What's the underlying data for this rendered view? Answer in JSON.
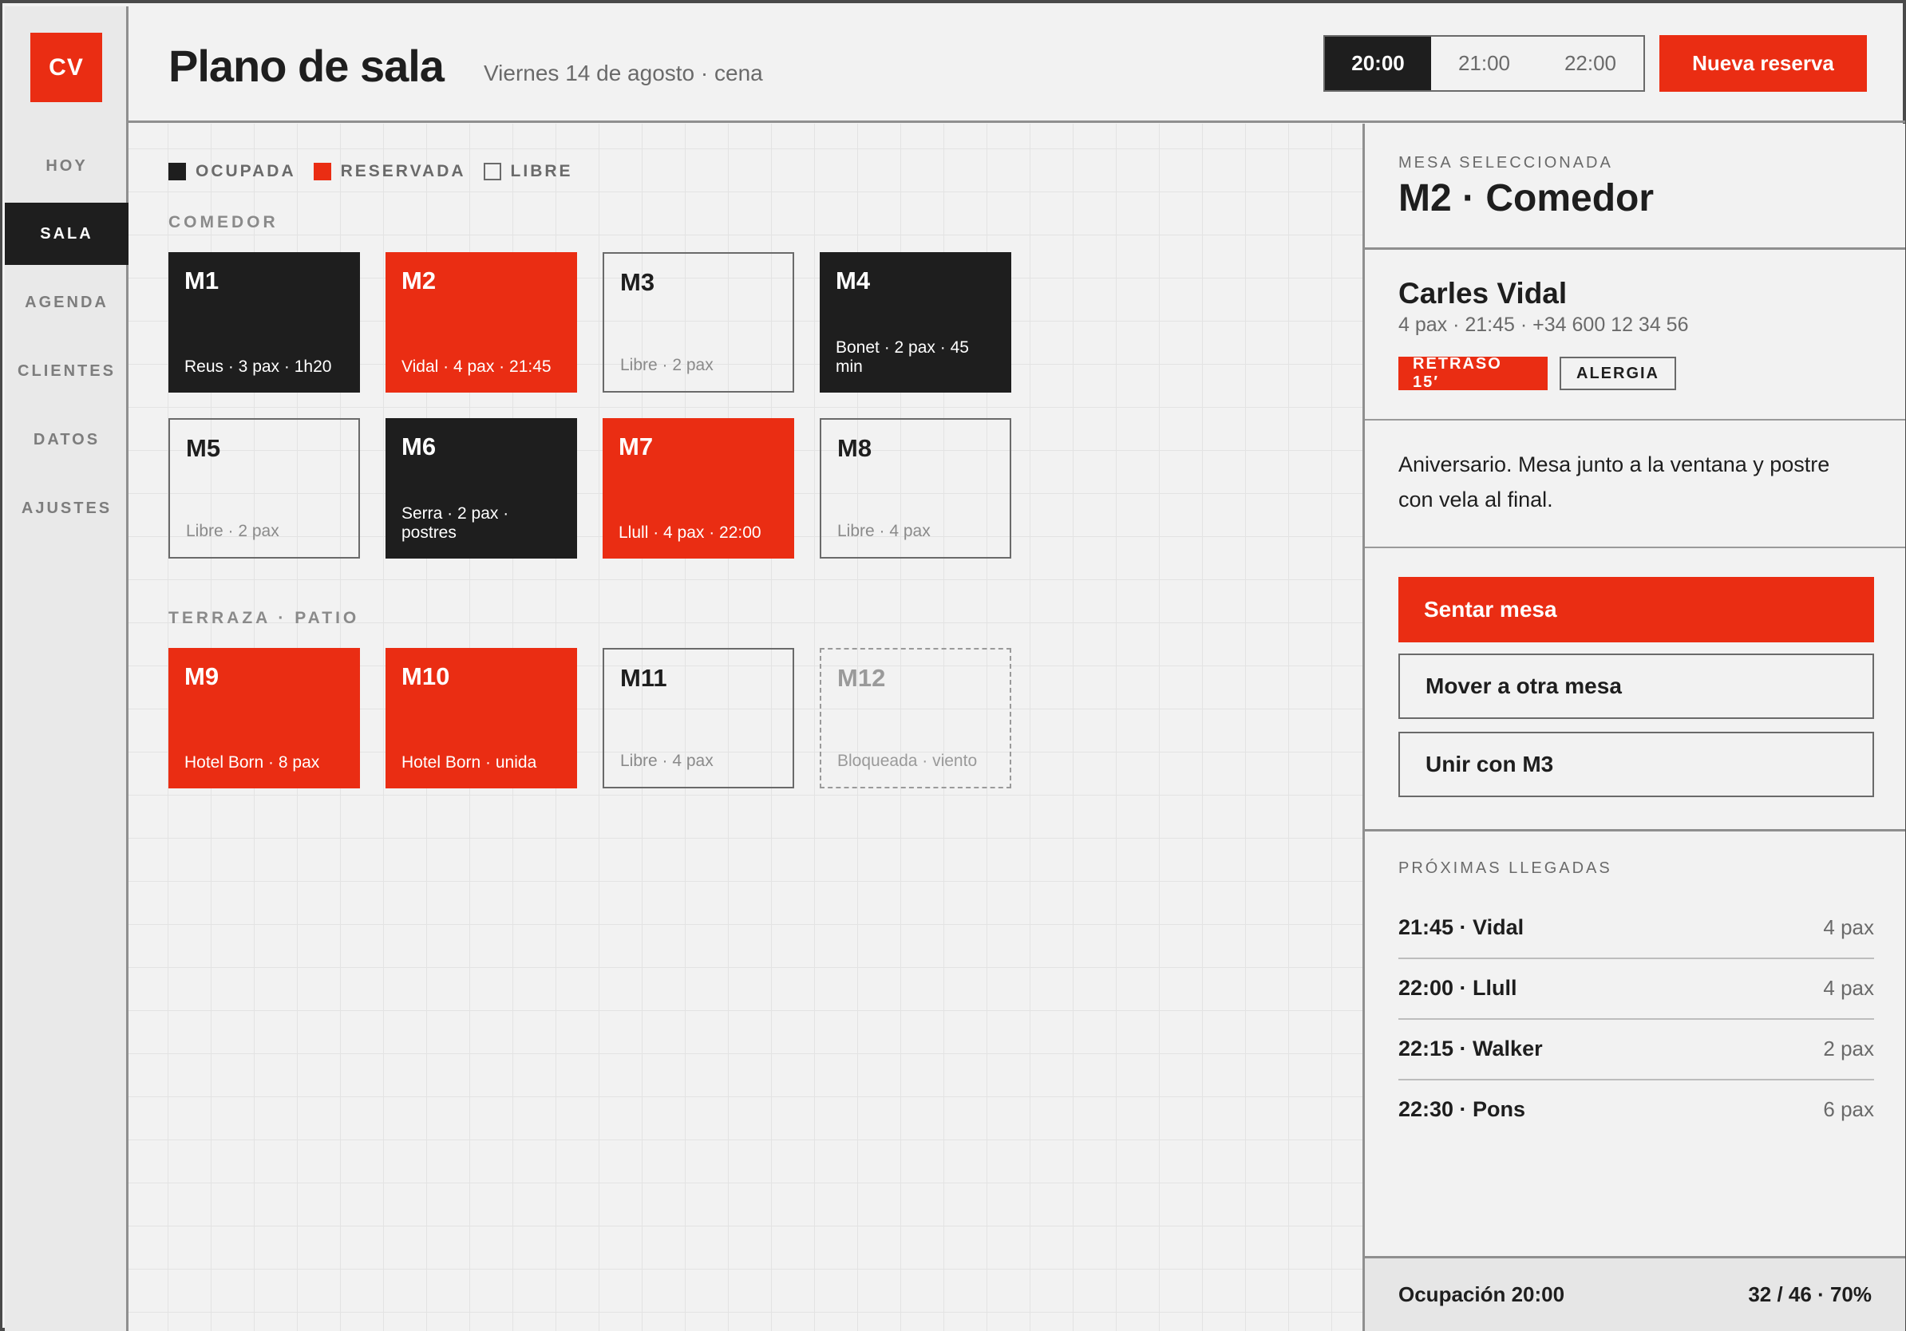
{
  "app": {
    "logo": "CV"
  },
  "sidebar": {
    "items": [
      {
        "label": "HOY"
      },
      {
        "label": "SALA",
        "active": true
      },
      {
        "label": "AGENDA"
      },
      {
        "label": "CLIENTES"
      },
      {
        "label": "DATOS"
      },
      {
        "label": "AJUSTES"
      }
    ]
  },
  "header": {
    "title": "Plano de sala",
    "subtitle": "Viernes 14 de agosto · cena",
    "times": [
      "20:00",
      "21:00",
      "22:00"
    ],
    "active_time": "20:00",
    "new_button": "Nueva reserva"
  },
  "legend": {
    "ocupada": "OCUPADA",
    "reservada": "RESERVADA",
    "libre": "LIBRE"
  },
  "sections": {
    "comedor": "COMEDOR",
    "terraza": "TERRAZA · PATIO"
  },
  "tables": {
    "m1": {
      "id": "M1",
      "info": "Reus · 3 pax · 1h20",
      "status": "ocupada"
    },
    "m2": {
      "id": "M2",
      "info": "Vidal · 4 pax · 21:45",
      "status": "reservada"
    },
    "m3": {
      "id": "M3",
      "info": "Libre · 2 pax",
      "status": "libre"
    },
    "m4": {
      "id": "M4",
      "info": "Bonet · 2 pax · 45 min",
      "status": "ocupada"
    },
    "m5": {
      "id": "M5",
      "info": "Libre · 2 pax",
      "status": "libre"
    },
    "m6": {
      "id": "M6",
      "info": "Serra · 2 pax · postres",
      "status": "ocupada"
    },
    "m7": {
      "id": "M7",
      "info": "Llull · 4 pax · 22:00",
      "status": "reservada"
    },
    "m8": {
      "id": "M8",
      "info": "Libre · 4 pax",
      "status": "libre"
    },
    "m9": {
      "id": "M9",
      "info": "Hotel Born · 8 pax",
      "status": "reservada"
    },
    "m10": {
      "id": "M10",
      "info": "Hotel Born · unida",
      "status": "reservada"
    },
    "m11": {
      "id": "M11",
      "info": "Libre · 4 pax",
      "status": "libre"
    },
    "m12": {
      "id": "M12",
      "info": "Bloqueada · viento",
      "status": "bloqueada"
    }
  },
  "panel": {
    "selected_label": "MESA SELECCIONADA",
    "selected_title": "M2 · Comedor",
    "guest_name": "Carles Vidal",
    "guest_meta": "4 pax · 21:45 · +34 600 12 34 56",
    "badges": {
      "delay": "RETRASO 15′",
      "allergy": "ALERGIA"
    },
    "note": "Aniversario. Mesa junto a la ventana y postre con vela al final.",
    "actions": {
      "seat": "Sentar mesa",
      "move": "Mover a otra mesa",
      "join": "Unir con M3"
    },
    "arrivals_label": "PRÓXIMAS LLEGADAS",
    "arrivals": [
      {
        "name": "21:45 · Vidal",
        "pax": "4 pax"
      },
      {
        "name": "22:00 · Llull",
        "pax": "4 pax"
      },
      {
        "name": "22:15 · Walker",
        "pax": "2 pax"
      },
      {
        "name": "22:30 · Pons",
        "pax": "6 pax"
      }
    ],
    "occupancy_label": "Ocupación 20:00",
    "occupancy_value": "32 / 46 · 70%"
  },
  "colors": {
    "accent": "#ea2d13",
    "dark": "#1e1e1e",
    "background": "#f2f2f2"
  }
}
